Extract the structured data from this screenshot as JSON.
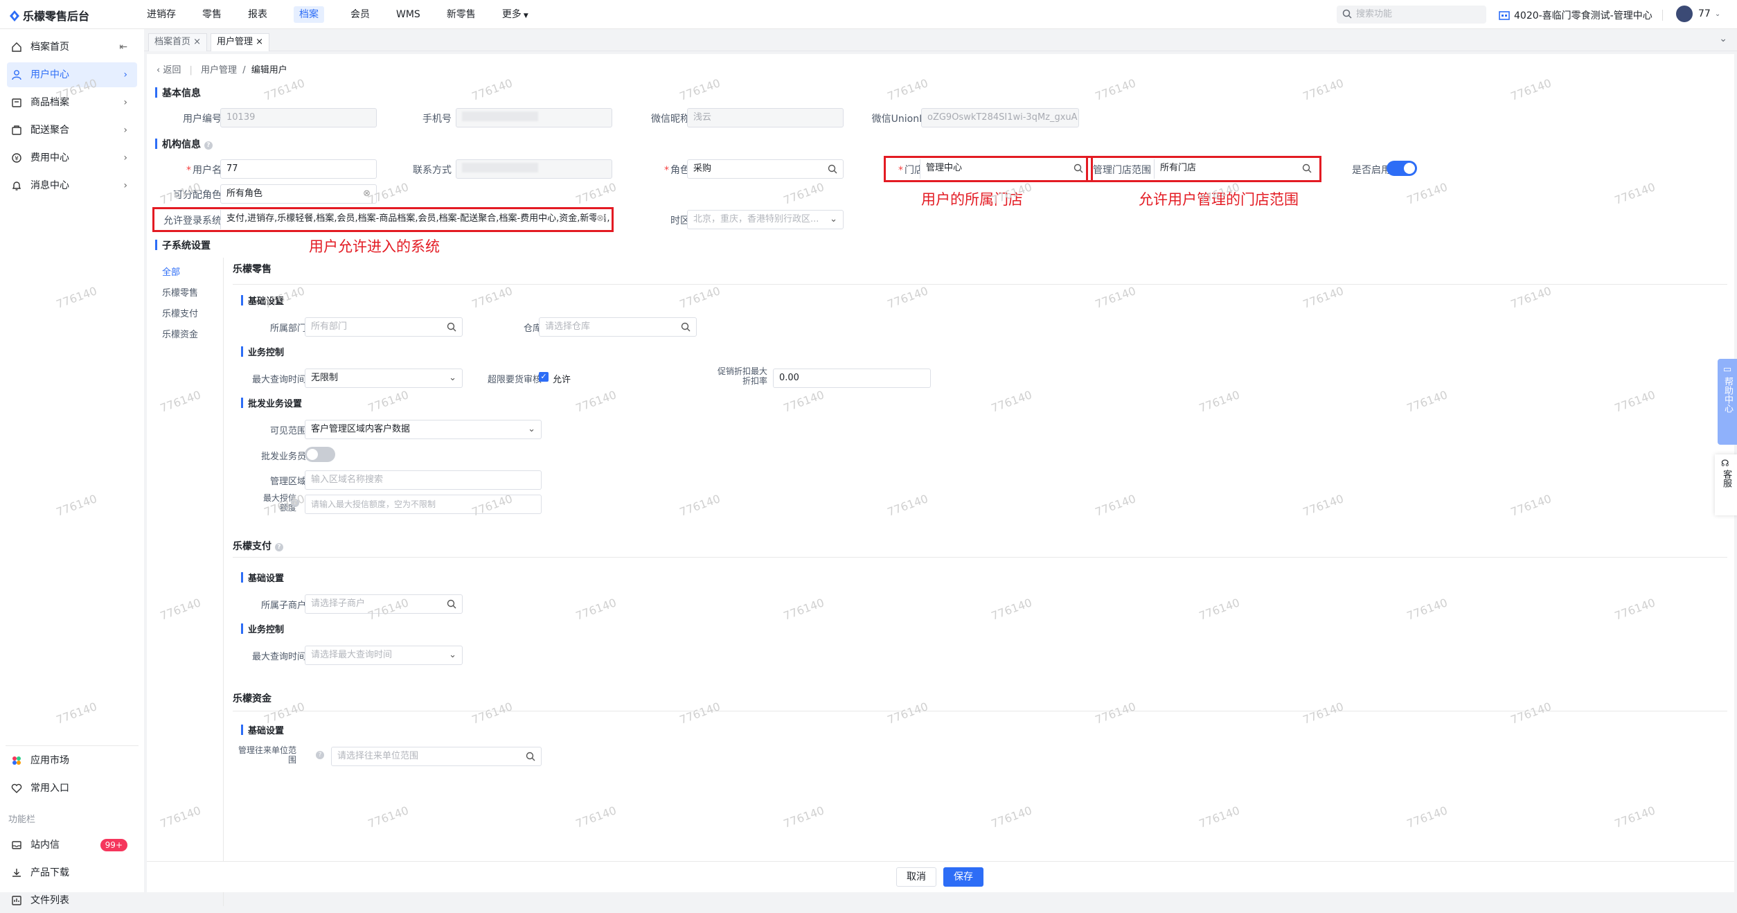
{
  "app": {
    "title": "乐檬零售后台"
  },
  "topnav": {
    "items": [
      "进销存",
      "零售",
      "报表",
      "档案",
      "会员",
      "WMS",
      "新零售",
      "更多"
    ],
    "active_index": 3
  },
  "search": {
    "placeholder": "搜索功能"
  },
  "store": {
    "name": "4020-喜临门零食测试-管理中心"
  },
  "user": {
    "name": "77"
  },
  "sidebar": {
    "items": [
      {
        "label": "档案首页",
        "icon": "home-icon"
      },
      {
        "label": "用户中心",
        "icon": "user-icon",
        "active": true
      },
      {
        "label": "商品档案",
        "icon": "goods-icon"
      },
      {
        "label": "配送聚合",
        "icon": "delivery-icon"
      },
      {
        "label": "费用中心",
        "icon": "expense-icon"
      },
      {
        "label": "消息中心",
        "icon": "bell-icon"
      }
    ],
    "bottom": [
      {
        "label": "应用市场",
        "icon": "app-market-icon"
      },
      {
        "label": "常用入口",
        "icon": "heart-icon"
      }
    ],
    "function_caption": "功能栏",
    "function_items": [
      {
        "label": "站内信",
        "icon": "mail-icon",
        "badge": "99+"
      },
      {
        "label": "产品下载",
        "icon": "download-icon"
      },
      {
        "label": "文件列表",
        "icon": "file-list-icon"
      }
    ]
  },
  "tabs": [
    {
      "label": "档案首页",
      "active": false
    },
    {
      "label": "用户管理",
      "active": true
    }
  ],
  "breadcrumb": {
    "back": "返回",
    "parent": "用户管理",
    "current": "编辑用户"
  },
  "basic": {
    "title": "基本信息",
    "user_no_label": "用户编号",
    "user_no": "10139",
    "phone_label": "手机号",
    "wechat_nick_label": "微信昵称",
    "wechat_nick": "浅云",
    "wechat_union_label": "微信UnionID",
    "wechat_union": "oZG9OswkT284SI1wi-3qMz_gxuA"
  },
  "org": {
    "title": "机构信息",
    "username_label": "用户名",
    "username": "77",
    "contact_label": "联系方式",
    "role_label": "角色",
    "role": "采购",
    "store_label": "门店",
    "store": "管理中心",
    "scope_label": "管理门店范围",
    "scope": "所有门店",
    "enabled_label": "是否启用",
    "assignable_label": "可分配角色",
    "assignable": "所有角色",
    "systems_label": "允许登录系统",
    "systems": "支付,进销存,乐檬轻餐,档案,会员,档案-商品档案,会员,档案-配送聚合,档案-费用中心,资金,新零售,新",
    "timezone_label": "时区",
    "timezone": "北京，重庆，香港特别行政区..."
  },
  "annotations": {
    "store": "用户的所属门店",
    "scope": "允许用户管理的门店范围",
    "systems": "用户允许进入的系统"
  },
  "subsystem": {
    "title": "子系统设置",
    "nav": [
      "全部",
      "乐檬零售",
      "乐檬支付",
      "乐檬资金"
    ],
    "retail": {
      "title": "乐檬零售",
      "basic_title": "基础设置",
      "dept_label": "所属部门",
      "dept_placeholder": "所有部门",
      "warehouse_label": "仓库",
      "warehouse_placeholder": "请选择仓库",
      "biz_title": "业务控制",
      "max_query_label": "最大查询时间",
      "max_query": "无限制",
      "over_order_label": "超限要货审核",
      "over_order_value": "允许",
      "discount_label_1": "促销折扣最大",
      "discount_label_2": "折扣率",
      "discount": "0.00",
      "wholesale_title": "批发业务设置",
      "visible_label": "可见范围",
      "visible": "客户管理区域内客户数据",
      "salesman_label": "批发业务员",
      "area_label": "管理区域",
      "area_placeholder": "输入区域名称搜索",
      "credit_label_1": "最大授信",
      "credit_label_2": "额度",
      "credit_placeholder": "请输入最大授信额度，空为不限制"
    },
    "pay": {
      "title": "乐檬支付",
      "basic_title": "基础设置",
      "merchant_label": "所属子商户",
      "merchant_placeholder": "请选择子商户",
      "biz_title": "业务控制",
      "max_query_label": "最大查询时间",
      "max_query_placeholder": "请选择最大查询时间"
    },
    "fund": {
      "title": "乐檬资金",
      "basic_title": "基础设置",
      "unit_label_1": "管理往来单位范",
      "unit_label_2": "围",
      "unit_placeholder": "请选择往来单位范围"
    }
  },
  "footer": {
    "cancel": "取消",
    "save": "保存"
  },
  "float": {
    "help": "帮助中心",
    "service": "客服"
  },
  "watermark": "776140"
}
